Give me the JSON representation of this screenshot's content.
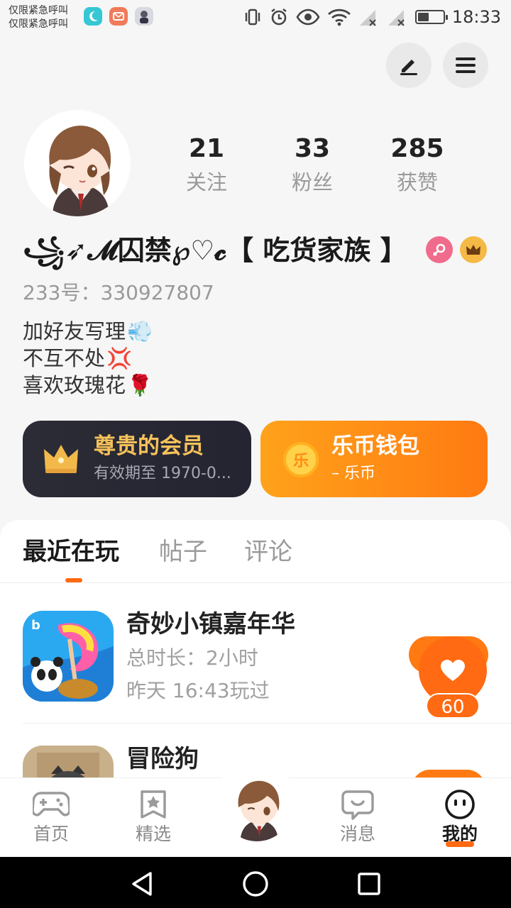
{
  "status_bar": {
    "carrier_line1": "仅限紧急呼叫",
    "carrier_line2": "仅限紧急呼叫",
    "time": "18:33",
    "battery_level": 0.45
  },
  "header": {
    "edit_icon": "edit-icon",
    "menu_icon": "menu-icon"
  },
  "profile": {
    "stats": [
      {
        "value": "21",
        "label": "关注"
      },
      {
        "value": "33",
        "label": "粉丝"
      },
      {
        "value": "285",
        "label": "获赞"
      }
    ],
    "nickname": "꧁➶𝓜囚禁℘♡𝓬【 吃货家族 】",
    "uid": "233号：330927807",
    "bio": [
      {
        "text": "加好友写理",
        "emoji": "💨"
      },
      {
        "text": "不互不处",
        "emoji": "💢"
      },
      {
        "text": "喜欢玫瑰花",
        "emoji": "🌹"
      }
    ]
  },
  "cards": {
    "vip": {
      "title": "尊贵的会员",
      "subtitle": "有效期至 1970-0..."
    },
    "wallet": {
      "title": "乐币钱包",
      "subtitle": "– 乐币",
      "coin_char": "乐"
    }
  },
  "tabs": [
    {
      "label": "最近在玩"
    },
    {
      "label": "帖子"
    },
    {
      "label": "评论"
    }
  ],
  "games": [
    {
      "name": "奇妙小镇嘉年华",
      "duration": "总时长：2小时",
      "last_played": "昨天 16:43玩过",
      "likes": "60"
    },
    {
      "name": "冒险狗"
    }
  ],
  "bottom_nav": [
    {
      "label": "首页",
      "icon": "gamepad-icon"
    },
    {
      "label": "精选",
      "icon": "star-bookmark-icon"
    },
    {
      "label": "消息",
      "icon": "chat-bubble-icon"
    },
    {
      "label": "我的",
      "icon": "smiley-icon"
    }
  ],
  "colors": {
    "accent": "#ff6a12",
    "vip_card": "#2a2a34",
    "wallet_card": "#ff8a14",
    "gold": "#f5b946"
  }
}
